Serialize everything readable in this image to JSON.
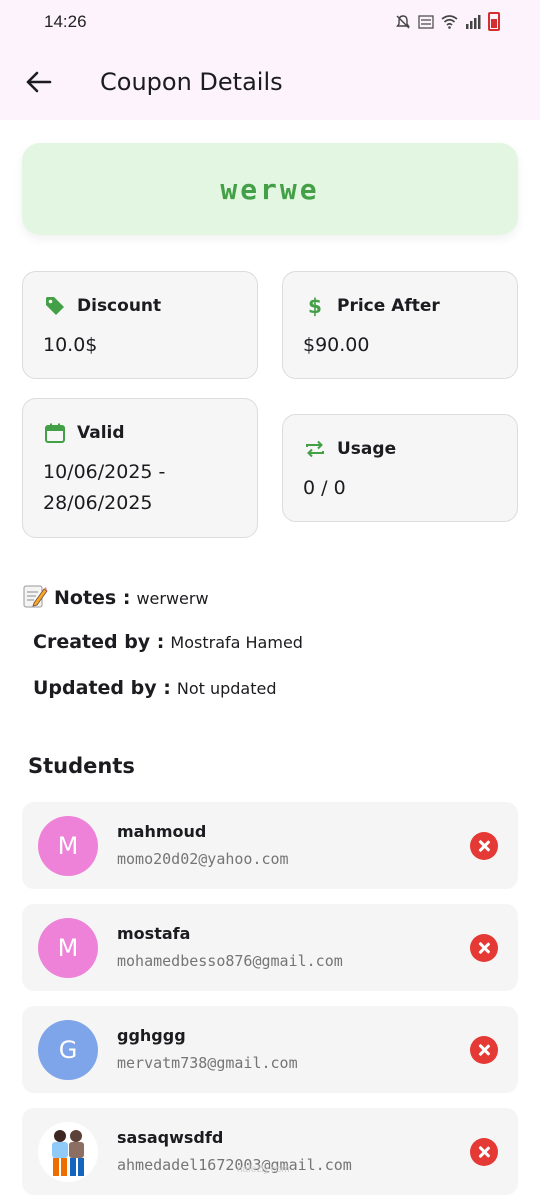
{
  "status_bar": {
    "time": "14:26",
    "icons": [
      "mute-icon",
      "volte-icon",
      "wifi-icon",
      "signal-icon",
      "battery-icon"
    ]
  },
  "app_bar": {
    "title": "Coupon Details"
  },
  "coupon": {
    "code": "werwe"
  },
  "cards": {
    "discount": {
      "label": "Discount",
      "value": "10.0$",
      "icon": "tag-icon"
    },
    "price_after": {
      "label": "Price After",
      "value": "$90.00",
      "icon": "dollar-icon"
    },
    "valid": {
      "label": "Valid",
      "value_line1": "10/06/2025 -",
      "value_line2": "28/06/2025",
      "icon": "calendar-icon"
    },
    "usage": {
      "label": "Usage",
      "value": "0 / 0",
      "icon": "repeat-icon"
    }
  },
  "details": {
    "notes_label": "Notes :",
    "notes_value": "werwerw",
    "created_label": "Created by :",
    "created_value": "Mostrafa Hamed",
    "updated_label": "Updated by :",
    "updated_value": "Not updated"
  },
  "students": {
    "title": "Students",
    "items": [
      {
        "initial": "M",
        "name": "mahmoud",
        "email": "momo20d02@yahoo.com",
        "avatar_color": "#ee82d8"
      },
      {
        "initial": "M",
        "name": "mostafa",
        "email": "mohamedbesso876@gmail.com",
        "avatar_color": "#ee82d8"
      },
      {
        "initial": "G",
        "name": "gghggg",
        "email": "mervatm738@gmail.com",
        "avatar_color": "#7ea4ea"
      },
      {
        "initial": "",
        "name": "sasaqwsdfd",
        "email": "ahmedadel1672003@gmail.com",
        "avatar_color": "#ffffff"
      }
    ]
  },
  "watermark": "nafezly.com",
  "colors": {
    "accent_green": "#43a047",
    "remove_red": "#e53935",
    "app_bar_bg": "#fcf3fc"
  }
}
